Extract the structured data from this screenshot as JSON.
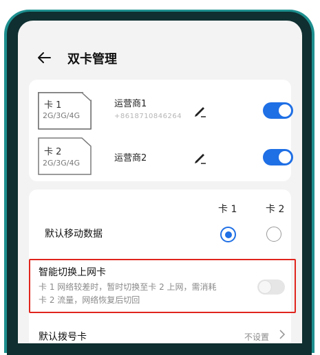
{
  "header": {
    "title": "双卡管理",
    "back_icon": "back-arrow-icon"
  },
  "sims": [
    {
      "name": "卡 1",
      "networks": "2G/3G/4G",
      "carrier": "运营商1",
      "number": "+8618710846264",
      "enabled": true,
      "edit_icon": "pencil-icon"
    },
    {
      "name": "卡 2",
      "networks": "2G/3G/4G",
      "carrier": "运营商2",
      "number": "",
      "enabled": true,
      "edit_icon": "pencil-icon"
    }
  ],
  "settings": {
    "col_sim1": "卡 1",
    "col_sim2": "卡 2",
    "default_data_label": "默认移动数据",
    "default_data_selected": "卡 1",
    "smart_switch": {
      "title": "智能切换上网卡",
      "desc_line1": "卡 1 网络较差时，暂时切换至卡 2 上网，需消耗",
      "desc_line2": "卡 2 流量，网络恢复后切回",
      "enabled": false
    },
    "default_dial_label": "默认拨号卡",
    "default_dial_value": "不设置"
  },
  "colors": {
    "accent": "#1f6fe5",
    "highlight": "#e0241d",
    "bezel": "#1e8f8f"
  }
}
